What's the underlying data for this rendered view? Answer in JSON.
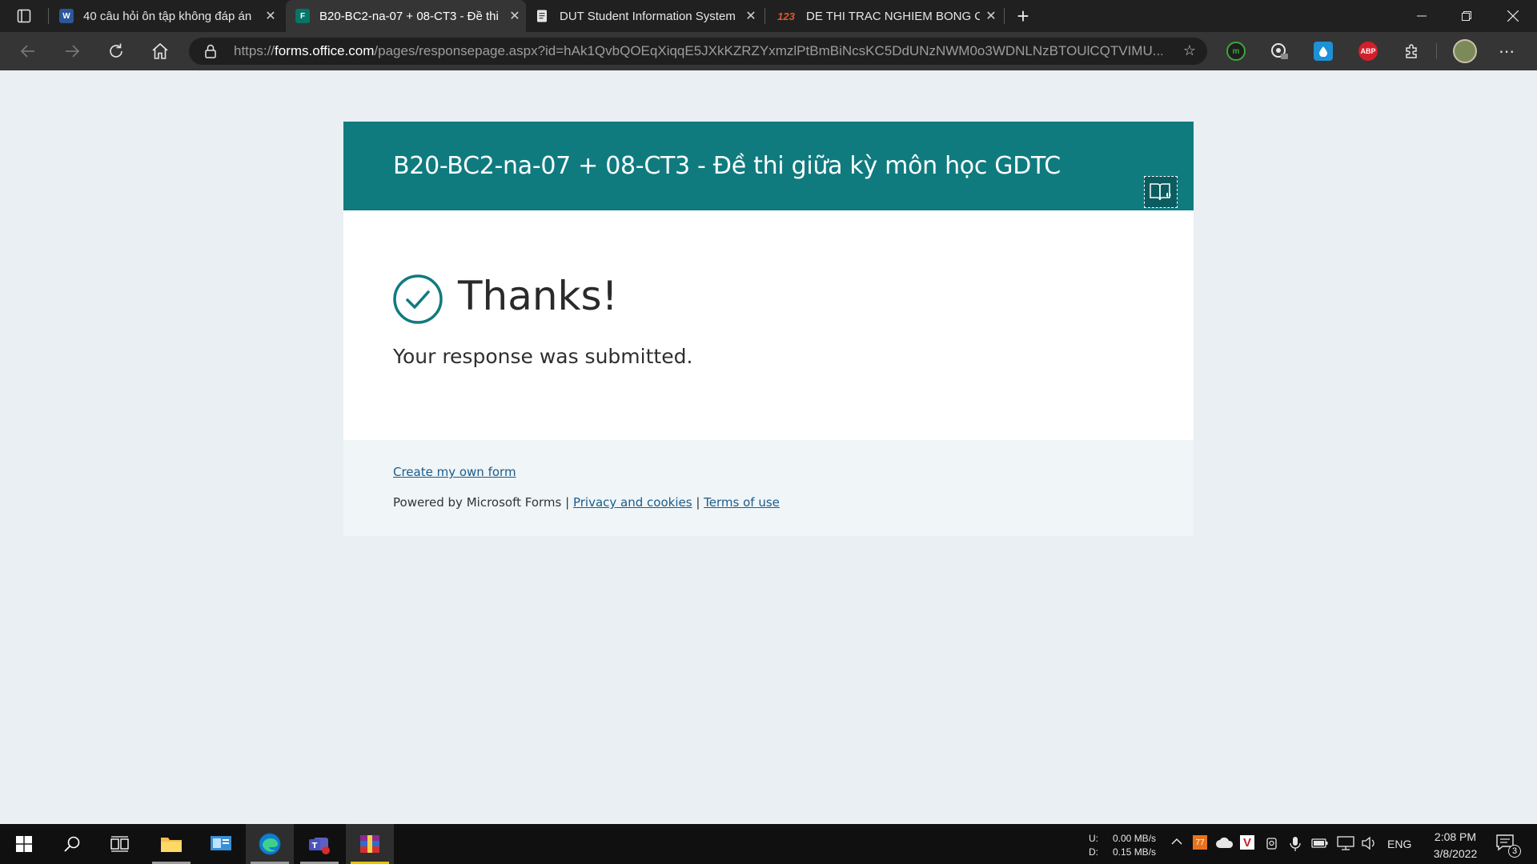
{
  "browser": {
    "tabs": [
      {
        "label": "40 câu hỏi ôn tập không đáp án",
        "icon": "word-icon",
        "favicon_text": "W",
        "favicon_color": "#2b579a"
      },
      {
        "label": "B20-BC2-na-07 + 08-CT3 - Đề thi",
        "icon": "forms-icon",
        "favicon_text": "F",
        "favicon_color": "#077568"
      },
      {
        "label": "DUT Student Information System",
        "icon": "document-icon",
        "favicon_text": "",
        "favicon_color": "#e6e6e6"
      },
      {
        "label": "DE THI TRAC NGHIEM BONG CH",
        "icon": "123doc-icon",
        "favicon_text": "123",
        "favicon_color": "#e0572b"
      }
    ],
    "address": {
      "scheme": "https://",
      "host": "forms.office.com",
      "path": "/pages/responsepage.aspx?id=hAk1QvbQOEqXiqqE5JXkKZRZYxmzlPtBmBiNcsKC5DdUNzNWM0o3WDNLNzBTOUlCQTVIMU..."
    },
    "extensions": [
      {
        "name": "grammar-extension-icon",
        "label": "m",
        "color": "#3aa83a"
      },
      {
        "name": "tracker-extension-icon",
        "label": "",
        "color": "#e6e6e6"
      },
      {
        "name": "droplet-extension-icon",
        "label": "",
        "color": "#1e90d6"
      },
      {
        "name": "adblock-plus-icon",
        "label": "ABP",
        "color": "#d41f2a"
      }
    ]
  },
  "form": {
    "title": "B20-BC2-na-07 + 08-CT3 - Đề thi giữa kỳ môn học GDTC",
    "thanks": "Thanks!",
    "message": "Your response was submitted.",
    "create_link": "Create my own form",
    "powered_by": "Powered by Microsoft Forms",
    "separator": "|",
    "privacy_link": "Privacy and cookies",
    "terms_link": "Terms of use",
    "accent_color": "#0f7b7f"
  },
  "taskbar": {
    "network": {
      "upload_label": "U:",
      "upload_value": "0.00 MB/s",
      "download_label": "D:",
      "download_value": "0.15 MB/s"
    },
    "tray_badge": "77",
    "language": "ENG",
    "time": "2:08 PM",
    "date": "3/8/2022",
    "notification_count": "3"
  }
}
